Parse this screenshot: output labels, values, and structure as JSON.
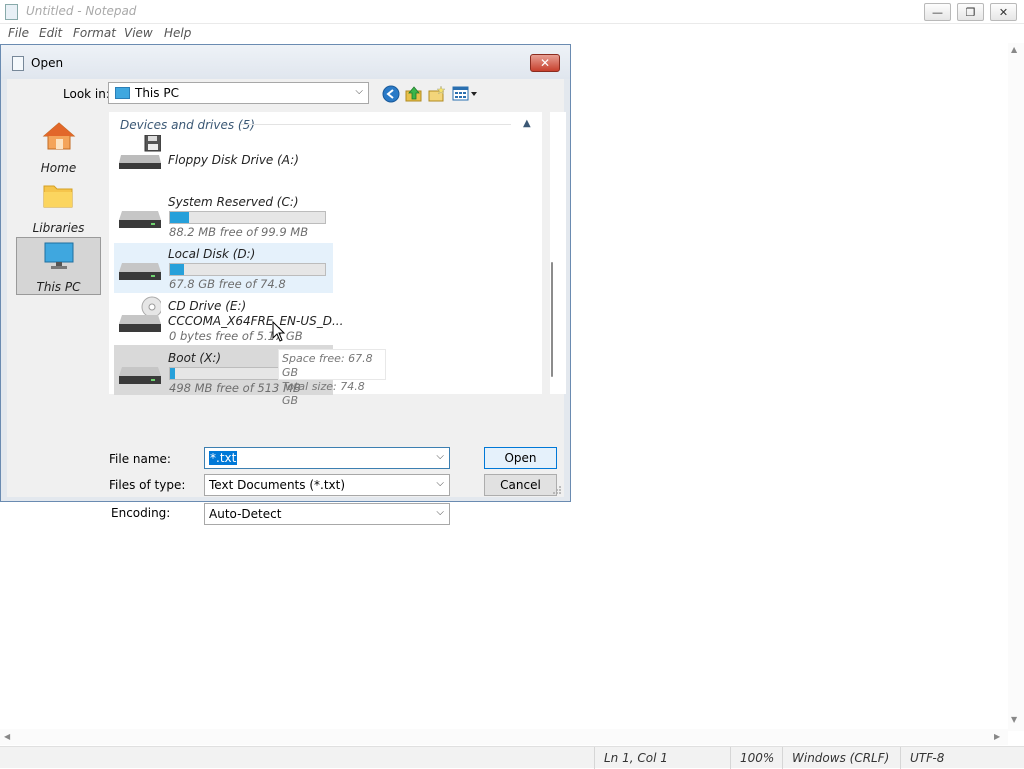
{
  "notepad": {
    "title": "Untitled - Notepad",
    "menu": [
      "File",
      "Edit",
      "Format",
      "View",
      "Help"
    ],
    "window_buttons": {
      "minimize": "—",
      "restore": "❐",
      "close": "✕"
    },
    "status": {
      "position": "Ln 1, Col 1",
      "zoom": "100%",
      "line_ending": "Windows (CRLF)",
      "encoding": "UTF-8"
    }
  },
  "dialog": {
    "title": "Open",
    "close_glyph": "✕",
    "look_in_label": "Look in:",
    "look_in_value": "This PC",
    "places": [
      {
        "label": "Home",
        "icon": "home-icon"
      },
      {
        "label": "Libraries",
        "icon": "folder-icon"
      },
      {
        "label": "This PC",
        "icon": "monitor-icon",
        "selected": true
      }
    ],
    "group_header": "Devices and drives (5)",
    "drives": [
      {
        "name": "Floppy Disk Drive (A:)",
        "free_text": "",
        "icon": "floppy-drive-icon"
      },
      {
        "name": "System Reserved (C:)",
        "free_text": "88.2 MB free of 99.9 MB",
        "used_fraction": 0.12,
        "icon": "hard-drive-icon"
      },
      {
        "name": "Local Disk (D:)",
        "free_text": "67.8 GB free of 74.8",
        "used_fraction": 0.09,
        "icon": "hard-drive-icon",
        "hover": true
      },
      {
        "name": "CD Drive (E:)",
        "label2": "CCCOMA_X64FRE_EN-US_D...",
        "free_text": "0 bytes free of 5.17 GB",
        "icon": "cd-drive-icon"
      },
      {
        "name": "Boot (X:)",
        "free_text": "498 MB free of 513 MB",
        "used_fraction": 0.03,
        "icon": "hard-drive-icon",
        "selected": true
      }
    ],
    "tooltip": {
      "line1": "Space free: 67.8 GB",
      "line2": "Total size: 74.8 GB"
    },
    "file_name_label": "File name:",
    "file_name_value": "*.txt",
    "files_of_type_label": "Files of type:",
    "files_of_type_value": "Text Documents (*.txt)",
    "encoding_label": "Encoding:",
    "encoding_value": "Auto-Detect",
    "open_button": "Open",
    "cancel_button": "Cancel",
    "accent_color": "#26a0da"
  }
}
